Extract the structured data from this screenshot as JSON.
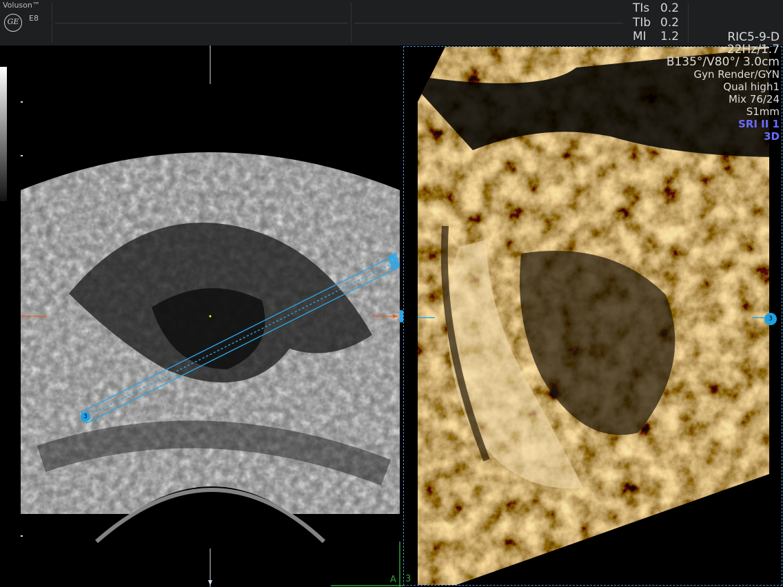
{
  "header": {
    "brand": "Voluson™",
    "logo_text": "GE",
    "model": "E8"
  },
  "params": [
    {
      "label": "TIs",
      "value": "0.2"
    },
    {
      "label": "TIb",
      "value": "0.2"
    },
    {
      "label": "MI",
      "value": "1.2"
    }
  ],
  "info": {
    "probe": "RIC5-9-D",
    "frame": "22Hz/1.7",
    "angles": "B135°/V80°/ 3.0cm",
    "render": "Gyn Render/GYN",
    "quality": "Qual high1",
    "mix": "Mix 76/24",
    "slice": "S1mm",
    "sri": "SRI II 1",
    "mode": "3D"
  },
  "markers": {
    "render_box": "3",
    "plane_a": "A",
    "plane_num": "3"
  },
  "colors": {
    "render_box": "#1ea0e0",
    "highlight": "#6b6cff",
    "plane_line": "#2fa030"
  }
}
